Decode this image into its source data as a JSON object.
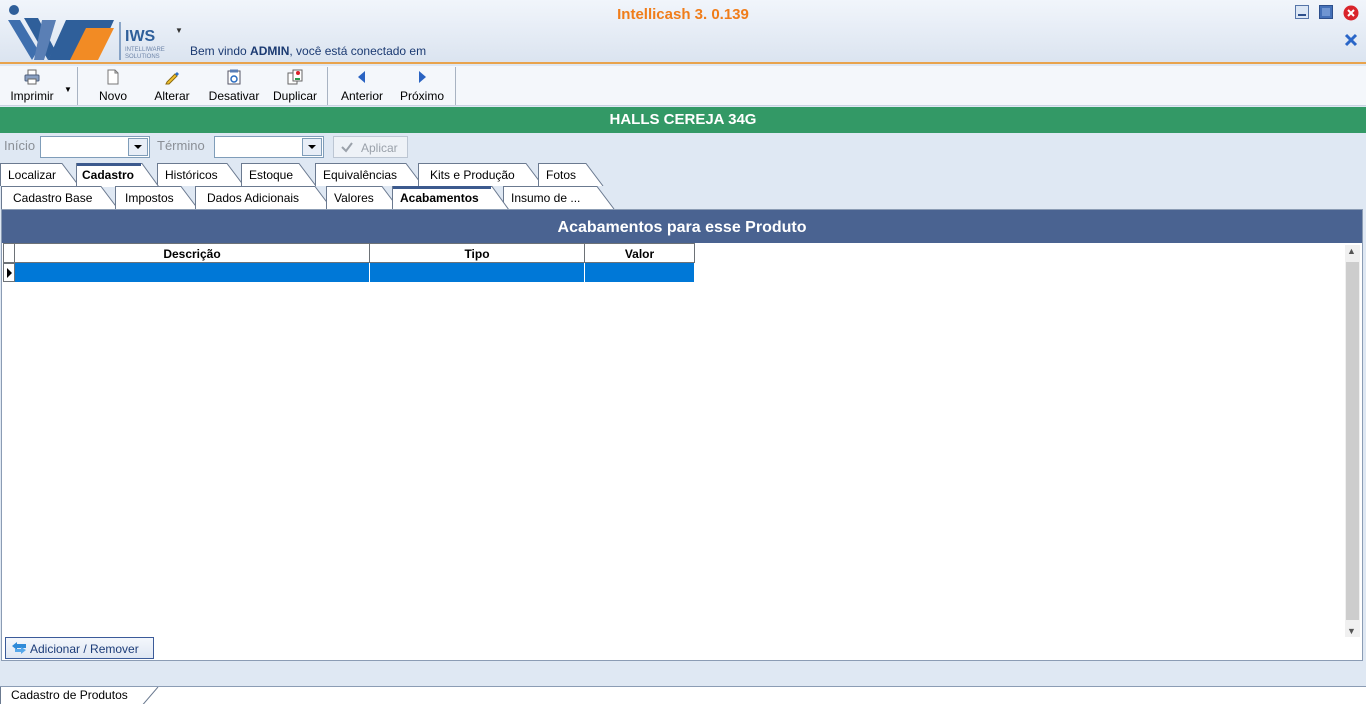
{
  "app": {
    "title": "Intellicash 3. 0.139",
    "logo_text": "IWS",
    "logo_sub1": "INTELLIWARE",
    "logo_sub2": "SOLUTIONS",
    "welcome_prefix": "Bem vindo ",
    "welcome_user": "ADMIN",
    "welcome_suffix": ", você está conectado em"
  },
  "toolbar": {
    "print": "Imprimir",
    "new": "Novo",
    "edit": "Alterar",
    "deactivate": "Desativar",
    "duplicate": "Duplicar",
    "previous": "Anterior",
    "next": "Próximo"
  },
  "product": {
    "name": "HALLS CEREJA 34G"
  },
  "filter": {
    "start_label": "Início",
    "end_label": "Término",
    "apply_label": "Aplicar",
    "start_value": "",
    "end_value": ""
  },
  "tabs_main": [
    {
      "label": "Localizar"
    },
    {
      "label": "Cadastro"
    },
    {
      "label": "Históricos"
    },
    {
      "label": "Estoque"
    },
    {
      "label": "Equivalências"
    },
    {
      "label": "Kits e Produção"
    },
    {
      "label": "Fotos"
    }
  ],
  "tabs_sub": [
    {
      "label": "Cadastro Base"
    },
    {
      "label": "Impostos"
    },
    {
      "label": "Dados Adicionais"
    },
    {
      "label": "Valores"
    },
    {
      "label": "Acabamentos"
    },
    {
      "label": "Insumo de ..."
    }
  ],
  "panel": {
    "title": "Acabamentos para esse Produto",
    "columns": [
      "Descrição",
      "Tipo",
      "Valor"
    ],
    "rows": [
      {
        "descricao": "",
        "tipo": "",
        "valor": ""
      }
    ],
    "add_remove_label": "Adicionar / Remover"
  },
  "bottom_tab": {
    "label": "Cadastro de Produtos"
  },
  "colors": {
    "accent_orange": "#f07d1a",
    "product_green": "#339966",
    "panel_header": "#4a6391",
    "selection_blue": "#0078d7"
  },
  "icons": [
    "printer-icon",
    "new-document-icon",
    "pencil-icon",
    "deactivate-icon",
    "duplicate-icon",
    "arrow-left-icon",
    "arrow-right-icon",
    "checkmark-icon",
    "swap-arrows-icon",
    "minimize-icon",
    "maximize-icon",
    "close-icon"
  ]
}
